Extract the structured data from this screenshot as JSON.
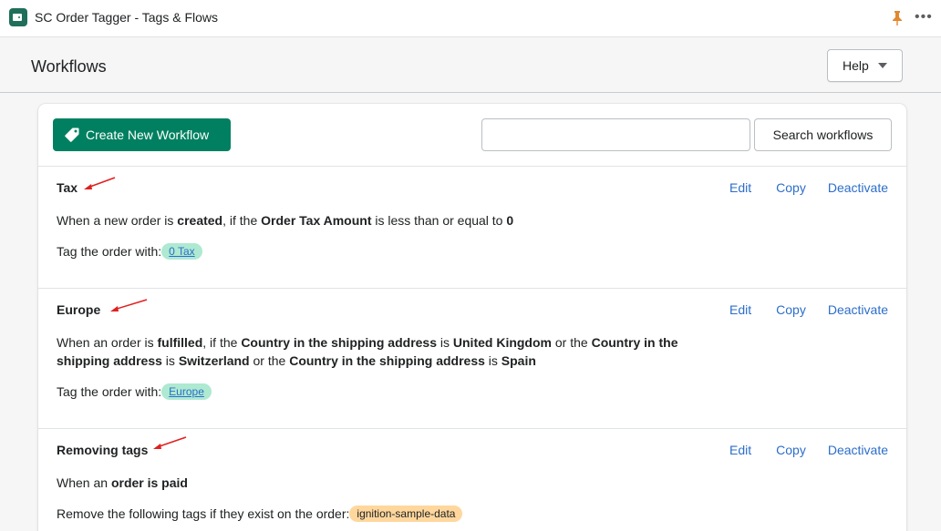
{
  "app": {
    "title": "SC Order Tagger - Tags & Flows",
    "icon": "app-tag-icon",
    "pin_icon": "pin-icon",
    "more_icon": "more-horizontal-icon"
  },
  "header": {
    "title": "Workflows",
    "help_label": "Help"
  },
  "toolbar": {
    "create_label": "Create New Workflow",
    "search_value": "",
    "search_placeholder": "",
    "search_label": "Search workflows"
  },
  "actions": {
    "edit": "Edit",
    "copy": "Copy",
    "deactivate": "Deactivate"
  },
  "workflows": [
    {
      "title": "Tax",
      "desc": [
        "When a new order is ",
        "created",
        ", if the ",
        "Order Tax Amount",
        " is less than or equal to ",
        "0"
      ],
      "tag_prefix": "Tag the order with:",
      "tag": "0 Tax"
    },
    {
      "title": "Europe",
      "desc": [
        "When an order is ",
        "fulfilled",
        ", if the ",
        "Country in the shipping address",
        " is ",
        "United Kingdom",
        " or the ",
        "Country in the shipping address",
        " is ",
        "Switzerland",
        " or the ",
        "Country in the shipping address",
        " is ",
        "Spain"
      ],
      "tag_prefix": "Tag the order with:",
      "tag": "Europe"
    },
    {
      "title": "Removing tags",
      "desc": [
        "When an ",
        "order is paid"
      ],
      "tag_prefix": "Remove the following tags if they exist on the order:",
      "tag": "ignition-sample-data"
    }
  ],
  "colors": {
    "primary": "#008060",
    "link": "#2c6ecb",
    "tag_green": "#aee9d1",
    "tag_orange": "#ffd79d",
    "annotation_arrow": "#e02020"
  }
}
